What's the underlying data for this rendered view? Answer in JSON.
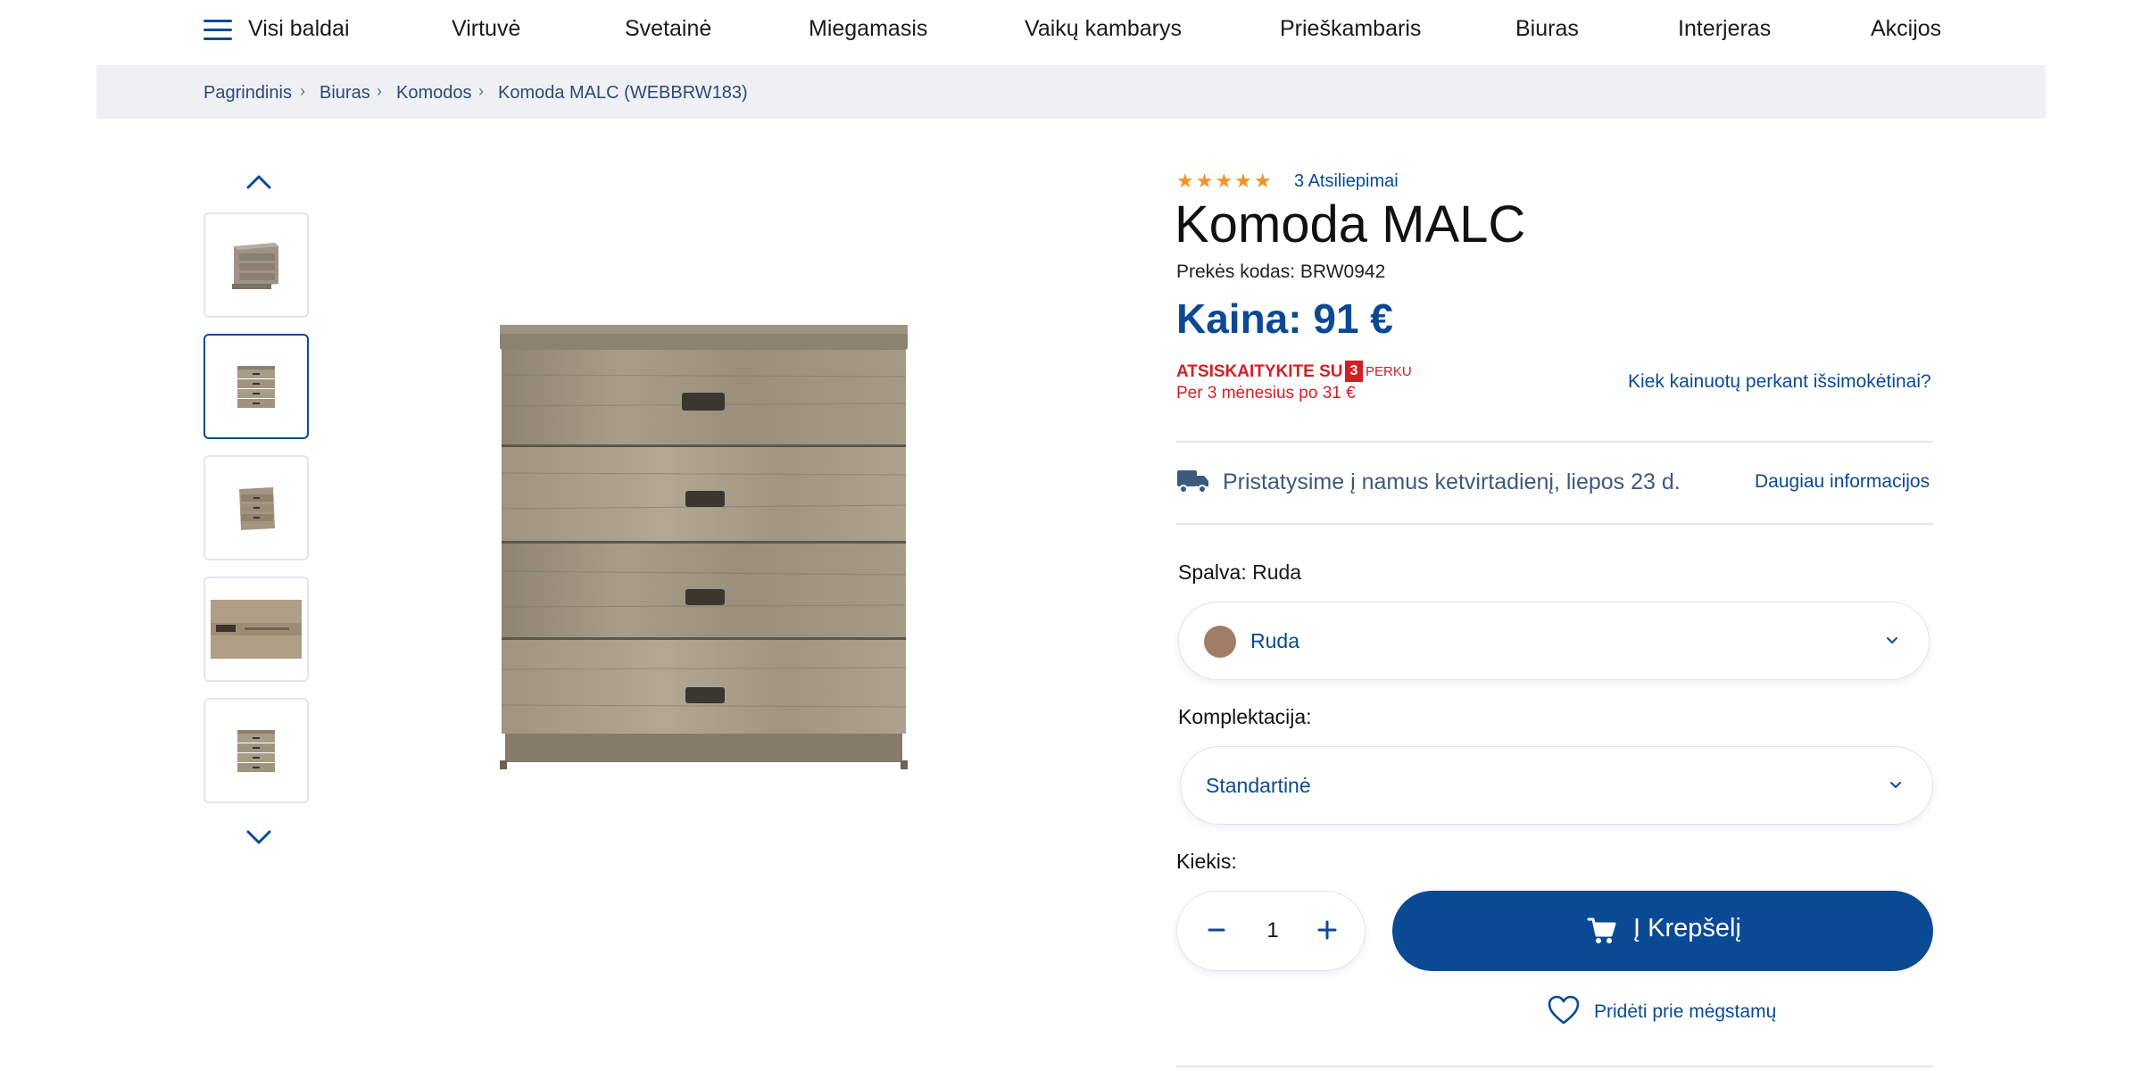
{
  "nav": {
    "menu_label": "Visi baldai",
    "items": [
      "Virtuvė",
      "Svetainė",
      "Miegamasis",
      "Vaikų kambarys",
      "Prieškambaris",
      "Biuras",
      "Interjeras",
      "Akcijos"
    ]
  },
  "breadcrumb": {
    "items": [
      "Pagrindinis",
      "Biuras",
      "Komodos",
      "Komoda MALC (WEBBRW183)"
    ]
  },
  "gallery": {
    "thumbnail_count": 5,
    "active_index": 1
  },
  "product": {
    "rating": 5,
    "reviews_label": "3 Atsiliepimai",
    "title": "Komoda MALC",
    "sku_label": "Prekės kodas:",
    "sku": "BRW0942",
    "price_label": "Kaina: 91 €"
  },
  "installment": {
    "title": "ATSISKAITYKITE SU",
    "badge": "3",
    "brand": "PERKU",
    "subtitle": "Per 3 mėnesius po 31 €",
    "link": "Kiek kainuotų perkant išsimokėtinai?"
  },
  "delivery": {
    "text": "Pristatysime į namus ketvirtadienį, liepos 23 d.",
    "link": "Daugiau informacijos"
  },
  "color": {
    "label": "Spalva:",
    "value": "Ruda",
    "selected": "Ruda",
    "swatch": "#a17d67"
  },
  "config": {
    "label": "Komplektacija:",
    "selected": "Standartinė"
  },
  "quantity": {
    "label": "Kiekis:",
    "value": "1"
  },
  "cart": {
    "label": "Į Krepšelį"
  },
  "wishlist": {
    "label": "Pridėti prie mėgstamų"
  },
  "colors": {
    "primary": "#0a4a94",
    "accent_red": "#d21f26",
    "star": "#f39325"
  }
}
